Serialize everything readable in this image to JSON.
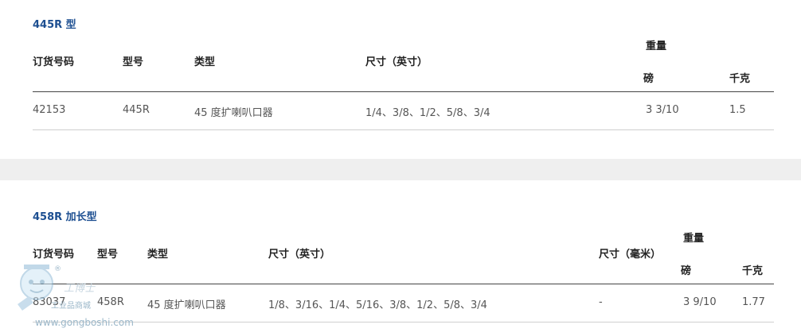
{
  "section1": {
    "title": "445R 型",
    "headers": {
      "order_no": "订货号码",
      "model": "型号",
      "type": "类型",
      "size_in": "尺寸（英寸）",
      "weight": "重量",
      "lb": "磅",
      "kg": "千克"
    },
    "row": {
      "order_no": "42153",
      "model": "445R",
      "type": "45 度扩喇叭口器",
      "size_in": "1/4、3/8、1/2、5/8、3/4",
      "lb": "3 3/10",
      "kg": "1.5"
    }
  },
  "section2": {
    "title": "458R 加长型",
    "headers": {
      "order_no": "订货号码",
      "model": "型号",
      "type": "类型",
      "size_in": "尺寸（英寸）",
      "size_mm": "尺寸（毫米）",
      "weight": "重量",
      "lb": "磅",
      "kg": "千克"
    },
    "row": {
      "order_no": "83037",
      "model": "458R",
      "type": "45 度扩喇叭口器",
      "size_in": "1/8、3/16、1/4、5/16、3/8、1/2、5/8、3/4",
      "size_mm": "-",
      "lb": "3 9/10",
      "kg": "1.77"
    }
  },
  "watermark": {
    "site": "www.gongboshi.com",
    "cn": "工业品商城",
    "cn2": "工博士",
    "reg": "®"
  }
}
